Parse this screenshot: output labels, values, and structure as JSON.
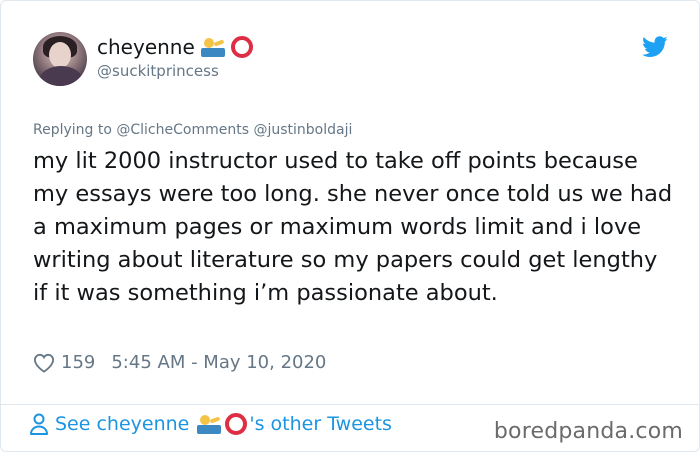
{
  "tweet": {
    "author": {
      "name": "cheyenne",
      "handle": "@suckitprincess",
      "name_emojis": [
        "swimmer-icon",
        "hollow-red-circle-icon"
      ]
    },
    "replying_to": "Replying to @ClicheComments @justinboldaji",
    "text": "my lit 2000 instructor used to take off points because my essays were too long. she never once told us we had a maximum pages or maximum words limit and i love writing about literature so my papers could get lengthy if it was something i’m passionate about.",
    "likes": "159",
    "timestamp": "5:45 AM - May 10, 2020"
  },
  "footer": {
    "see_prefix": "See cheyenne",
    "see_suffix": "'s other Tweets"
  },
  "watermark": "boredpanda.com",
  "colors": {
    "twitter_blue": "#1da1f2",
    "link_blue": "#1b95e0",
    "muted_gray": "#657786",
    "text": "#14171a"
  }
}
